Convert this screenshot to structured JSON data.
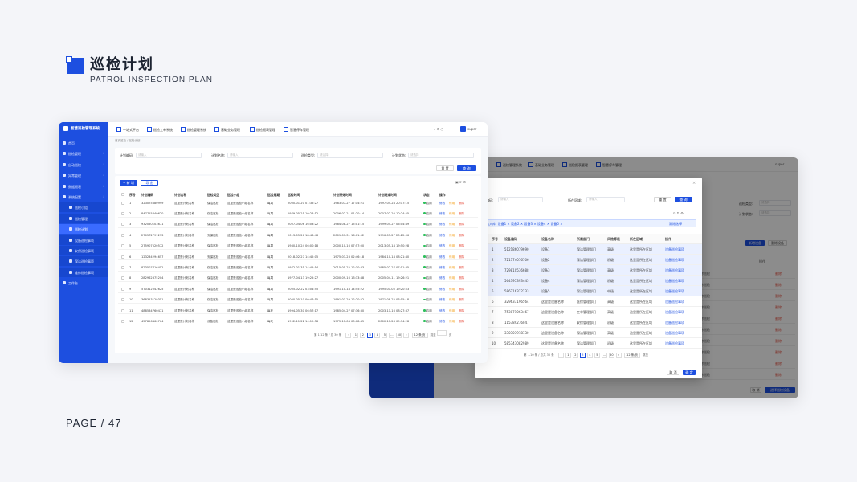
{
  "heading": {
    "title": "巡检计划",
    "subtitle": "PATROL INSPECTION PLAN"
  },
  "footer": {
    "page": "PAGE / 47"
  },
  "main_window": {
    "app_name": "智慧巡检管理系统",
    "top_tabs": [
      "一站式平台",
      "巡检工单系统",
      "巡检管理系统",
      "基础业务管理",
      "巡检报表管理",
      "智慧停车管理"
    ],
    "user": "super",
    "sidebar": [
      {
        "label": "首页",
        "type": "item"
      },
      {
        "label": "巡检管理",
        "type": "item"
      },
      {
        "label": "自动巡检",
        "type": "item"
      },
      {
        "label": "异常管理",
        "type": "item"
      },
      {
        "label": "数据报表",
        "type": "item"
      },
      {
        "label": "系统配置",
        "type": "item"
      },
      {
        "label": "巡检小组",
        "type": "sub"
      },
      {
        "label": "巡检管理",
        "type": "sub"
      },
      {
        "label": "巡检计划",
        "type": "sub-active"
      },
      {
        "label": "设备巡检事项",
        "type": "sub"
      },
      {
        "label": "安保巡检事项",
        "type": "sub"
      },
      {
        "label": "保洁巡检事项",
        "type": "sub"
      },
      {
        "label": "维修巡检事项",
        "type": "sub"
      },
      {
        "label": "工作台",
        "type": "item"
      }
    ],
    "breadcrumb": "首页巡检  /  巡检计划",
    "filters": [
      {
        "label": "计划编码:",
        "placeholder": "请输入"
      },
      {
        "label": "计划名称:",
        "placeholder": "请输入"
      },
      {
        "label": "巡检类型:",
        "placeholder": "请选择"
      },
      {
        "label": "计划状态:",
        "placeholder": "请选择"
      }
    ],
    "reset_label": "重 置",
    "search_label": "查 询",
    "add_label": "+ 新 增",
    "import_label": "导 出",
    "columns": [
      "序号",
      "计划编码",
      "计划名称",
      "巡检类型",
      "巡检小组",
      "巡检周期",
      "巡检时间",
      "计划开始时间",
      "计划结束时间",
      "状态",
      "操作"
    ],
    "rows": [
      [
        "1",
        "323075680999",
        "这里是计划名称",
        "保洁巡检",
        "这里是巡检小组名称",
        "每周",
        "2000-01-20 01:35:27",
        "1983-07-27 17:14:21",
        "1997-04-24 20:17:15",
        "启用"
      ],
      [
        "2",
        "847725840620",
        "这里是计划名称",
        "保洁巡检",
        "这里是巡检小组名称",
        "每周",
        "1979-05-25 10:24:52",
        "2006-02-21 01:20:14",
        "2007-02-20 10:24:55",
        "启用"
      ],
      [
        "3",
        "932050103671",
        "这里是计划名称",
        "保洁巡检",
        "这里是巡检小组名称",
        "每周",
        "2007-04-06 16:03:22",
        "1984-08-27 15:01:15",
        "1999-05-27 06:04:49",
        "启用"
      ],
      [
        "4",
        "270572791233",
        "这里是计划名称",
        "安保巡检",
        "这里是巡检小组名称",
        "每周",
        "2013-05-26 18:46:48",
        "2001-07-31 16:01:52",
        "1996-05-27 20:22:06",
        "启用"
      ],
      [
        "5",
        "275907520572",
        "这里是计划名称",
        "保洁巡检",
        "这里是巡检小组名称",
        "每周",
        "1980-10-24 06:00:18",
        "2000-10-16 07:57:00",
        "2013-05-14 19:50:28",
        "启用"
      ],
      [
        "6",
        "123234294657",
        "这里是计划名称",
        "安保巡检",
        "这里是巡检小组名称",
        "每周",
        "2018-02-27 14:42:05",
        "1975-03-23 02:46:18",
        "1984-10-14 08:21:40",
        "启用"
      ],
      [
        "7",
        "823507716452",
        "这里是计划名称",
        "保洁巡检",
        "这里是巡检小组名称",
        "每周",
        "1972-01-31 14:45:54",
        "2015-05-22 12:30:33",
        "1985-02-27 07:51:35",
        "启用"
      ],
      [
        "8",
        "282962375204",
        "这里是计划名称",
        "保洁巡检",
        "这里是巡检小组名称",
        "每周",
        "1977-04-13 19:25:27",
        "2000-09-16 13:33:48",
        "2005-04-11 19:26:21",
        "启用"
      ],
      [
        "9",
        "570312042625",
        "这里是计划名称",
        "保洁巡检",
        "这里是巡检小组名称",
        "每周",
        "2005-02-22 03:04:55",
        "1991-10-14 14:45:22",
        "1995-01-05 19:20:53",
        "启用"
      ],
      [
        "10",
        "368353129351",
        "这里是计划名称",
        "保洁巡检",
        "这里是巡检小组名称",
        "每周",
        "2000-05-10 00:46:15",
        "1991-03-29 12:20:22",
        "1971-08-22 03:55:18",
        "启用"
      ],
      [
        "11",
        "488584760471",
        "这里是计划名称",
        "保洁巡检",
        "这里是巡检小组名称",
        "每天",
        "1994-05-30 06:57:17",
        "1985-04-27 07:36:30",
        "2003-11-16 08:27:37",
        "启用"
      ],
      [
        "12",
        "457826460764",
        "这里是计划名称",
        "设备巡检",
        "这里是巡检小组名称",
        "每天",
        "1992-11-22 14:19:58",
        "1975-11-04 00:08:45",
        "2000-11-28 09:34:28",
        "启用"
      ]
    ],
    "ops": [
      "修改",
      "停用",
      "删除"
    ],
    "pagination": {
      "summary": "第 1-12 条 / 总 30 条",
      "pages": [
        "1",
        "2",
        "3",
        "4",
        "5",
        "...",
        "50"
      ],
      "current": "3",
      "page_size": "12 条/页",
      "jump": "跳至",
      "jump_suffix": "页"
    }
  },
  "back_window": {
    "top_tabs": [
      "巡检管理系统",
      "基础业务管理",
      "巡检报表管理",
      "智慧停车管理"
    ],
    "user": "super",
    "filters": [
      "巡检类型:",
      "计划状态:"
    ],
    "placeholder": "请选择",
    "add_label": "新增设备",
    "delete_label": "删除设备",
    "col_op": "操作",
    "row_text": "巡检区域、设备名称巡检",
    "row_op": "删除",
    "cancel": "取 消",
    "confirm": "选择巡检设备"
  },
  "modal": {
    "title": "设备",
    "field1_label": "设备编码:",
    "field1_placeholder": "请输入",
    "field2_label": "所在区域:",
    "field2_placeholder": "请输入",
    "reset": "重 置",
    "search": "查 询",
    "sub_title": "设备",
    "selected": "已选入库: 设备1 × 设备2 × 设备3 × 设备4 × 设备5 ×",
    "clear": "清除选择",
    "columns": [
      "序号",
      "设备编码",
      "设备名称",
      "所属部门",
      "风险等级",
      "所在区域",
      "操作"
    ],
    "rows": [
      [
        "1",
        "512186079690",
        "设备1",
        "保洁管理部门",
        "高级",
        "这里是所在区域",
        "设备巡检事项"
      ],
      [
        "2",
        "721774076706",
        "设备2",
        "保洁管理部门",
        "初级",
        "这里是所在区域",
        "设备巡检事项"
      ],
      [
        "3",
        "729810536688",
        "设备3",
        "保洁管理部门",
        "高级",
        "这里是所在区域",
        "设备巡检事项"
      ],
      [
        "4",
        "564395393445",
        "设备4",
        "保洁管理部门",
        "初级",
        "这里是所在区域",
        "设备巡检事项"
      ],
      [
        "5",
        "586216322233",
        "设备5",
        "保洁管理部门",
        "中级",
        "这里是所在区域",
        "设备巡检事项"
      ],
      [
        "6",
        "329633196564",
        "这里是设备名称",
        "医保管理部门",
        "高级",
        "这里是所在区域",
        "设备巡检事项"
      ],
      [
        "7",
        "753071063467",
        "这里是设备名称",
        "工单管理部门",
        "高级",
        "这里是所在区域",
        "设备巡检事项"
      ],
      [
        "8",
        "115789276047",
        "这里是设备名称",
        "安保管理部门",
        "初级",
        "这里是所在区域",
        "设备巡检事项"
      ],
      [
        "9",
        "330303918730",
        "这里是设备名称",
        "保洁管理部门",
        "高级",
        "这里是所在区域",
        "设备巡检事项"
      ],
      [
        "10",
        "585343082989",
        "这里是设备名称",
        "保洁管理部门",
        "初级",
        "这里是所在区域",
        "设备巡检事项"
      ]
    ],
    "pager_summary": "第 1-10 条 / 总共 30 条",
    "pages": [
      "1",
      "2",
      "3",
      "4",
      "5",
      "...",
      "50"
    ],
    "page_size": "12 条/页",
    "jump": "跳至",
    "cancel": "取 消",
    "ok": "确 定"
  },
  "colors": {
    "primary": "#1d4fe0",
    "bg": "#f4f5f9",
    "success": "#2ec05c"
  }
}
